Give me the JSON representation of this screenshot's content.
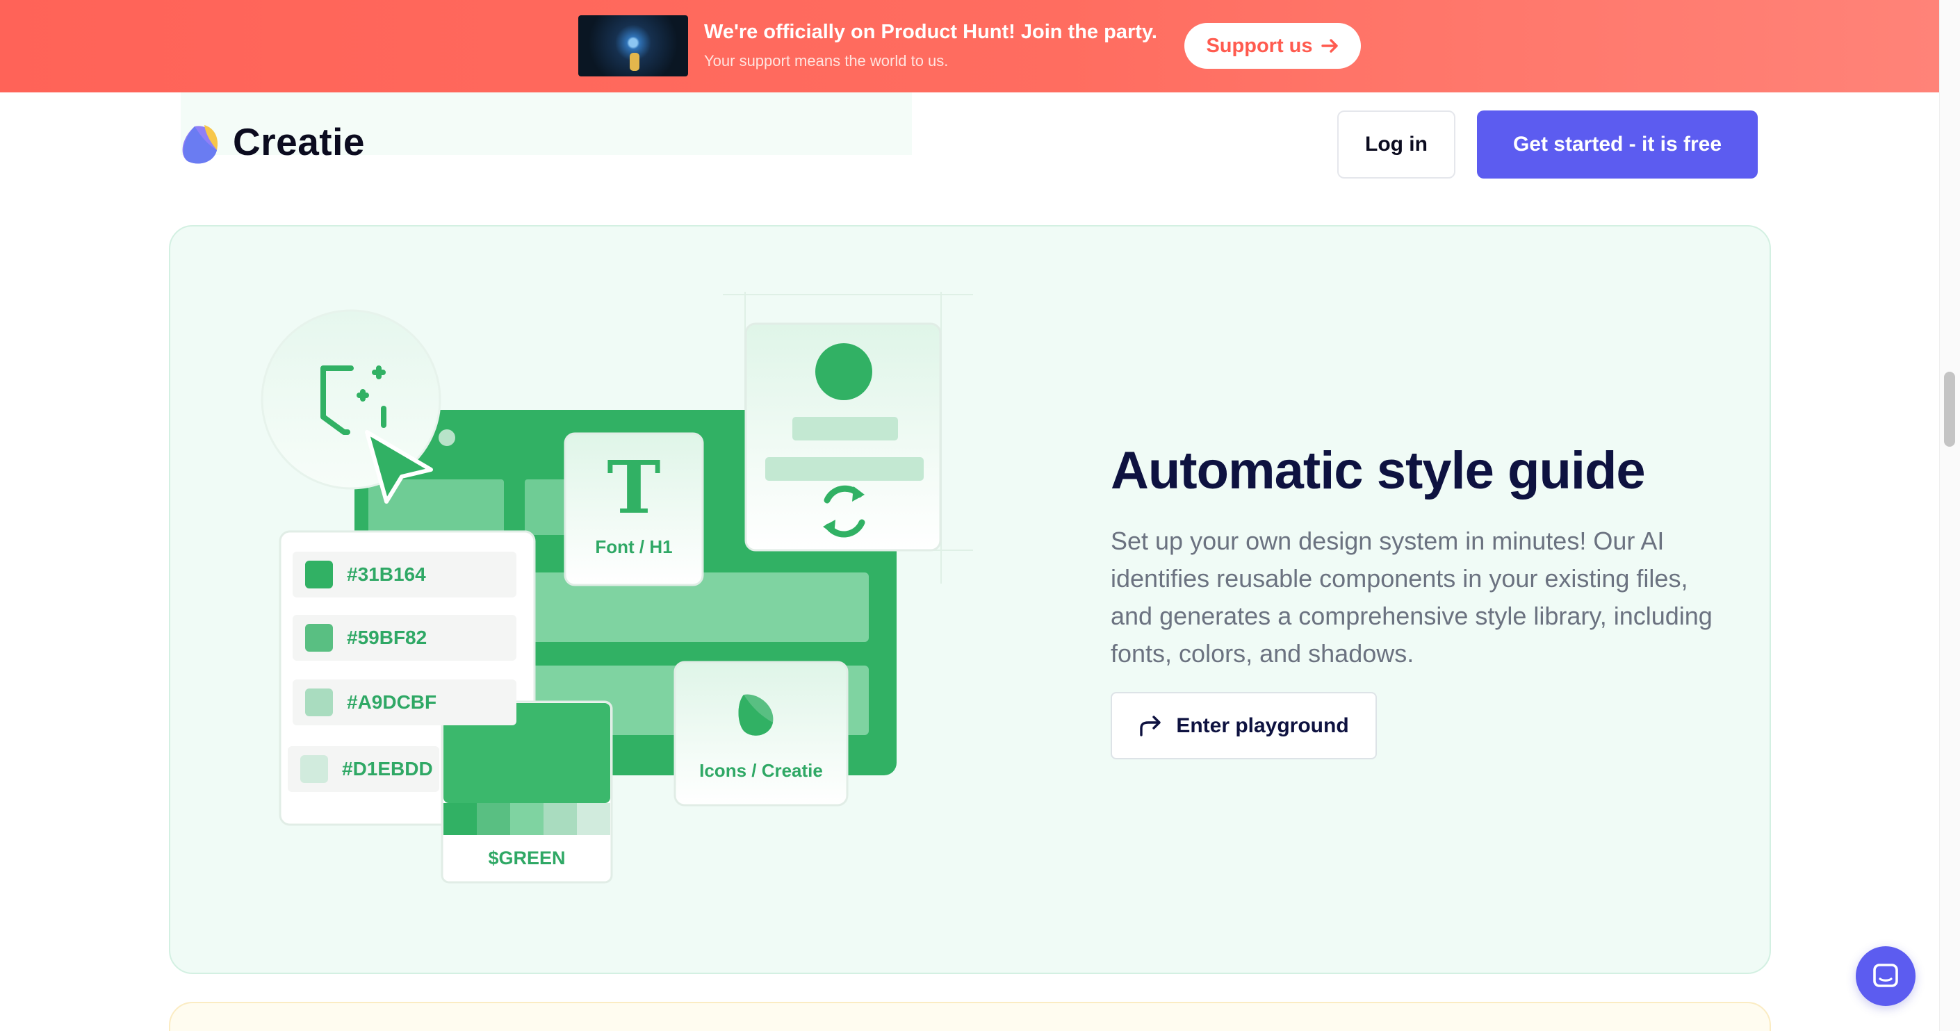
{
  "banner": {
    "title": "We're officially on Product Hunt! Join the party.",
    "subtitle": "Your support means the world to us.",
    "support_label": "Support us",
    "background_color": "#ff6358"
  },
  "header": {
    "brand": "Creatie",
    "login_label": "Log in",
    "cta_label": "Get started - it is free",
    "accent_color": "#5c5cf0"
  },
  "feature": {
    "title": "Automatic style guide",
    "description": "Set up your own design system in minutes! Our AI identifies reusable components in your existing files, and generates a comprehensive style library, including fonts, colors, and shadows.",
    "cta_label": "Enter playground",
    "cta_icon": "redo-arrow-icon",
    "background_color": "#f0fbf6"
  },
  "illustration": {
    "swatches": [
      {
        "hex": "#31B164",
        "color": "#31B164"
      },
      {
        "hex": "#59BF82",
        "color": "#59BF82"
      },
      {
        "hex": "#A9DCBF",
        "color": "#A9DCBF"
      },
      {
        "hex": "#D1EBDD",
        "color": "#D1EBDD"
      }
    ],
    "font_card": {
      "glyph": "T",
      "label": "Font / H1"
    },
    "icons_card_label": "Icons / Creatie",
    "palette_card_label": "$GREEN",
    "primary_green": "#31b164"
  },
  "chat": {
    "icon": "chat-icon"
  }
}
